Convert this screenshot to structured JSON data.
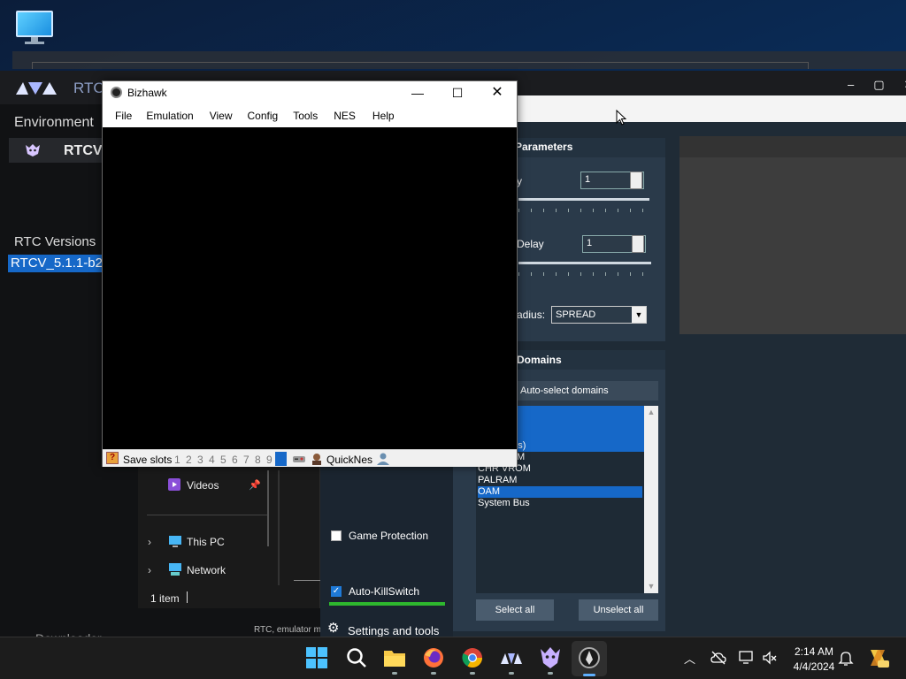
{
  "rtc_launcher": {
    "title": "RTC",
    "environment_label": "Environment",
    "environment_item": "RTCV",
    "versions_label": "RTC Versions",
    "version_selected": "RTCV_5.1.1-b2",
    "footer_text": "RTC, emulator mo",
    "downloader_label": "Downloader",
    "window_controls": [
      "–",
      "▢",
      "✕"
    ]
  },
  "rtc_client": {
    "parameters_header": "Parameters",
    "intensity_label": "y",
    "intensity_value": "1",
    "delay_label": "Delay",
    "delay_value": "1",
    "radius_label": "adius:",
    "radius_value": "SPREAD",
    "domains_header": "Domains",
    "autoselect_label": "Auto-select domains",
    "domains": [
      {
        "label": "ametables)",
        "selected": true
      },
      {
        "label": "CHR VROM",
        "selected": false
      },
      {
        "label": "PALRAM",
        "selected": false
      },
      {
        "label": "OAM",
        "selected": true
      },
      {
        "label": "System Bus",
        "selected": false
      }
    ],
    "domain_partial_m": "M",
    "select_all_label": "Select all",
    "unselect_all_label": "Unselect all",
    "game_protection_label": "Game Protection",
    "game_protection_checked": false,
    "auto_killswitch_label": "Auto-KillSwitch",
    "auto_killswitch_checked": true,
    "settings_label": "Settings and tools"
  },
  "explorer": {
    "videos_label": "Videos",
    "this_pc_label": "This PC",
    "network_label": "Network",
    "status_text": "1 item"
  },
  "bizhawk": {
    "title": "Bizhawk",
    "menu": [
      "File",
      "Emulation",
      "View",
      "Config",
      "Tools",
      "NES",
      "Help"
    ],
    "save_slots_label": "Save slots",
    "slots": [
      "1",
      "2",
      "3",
      "4",
      "5",
      "6",
      "7",
      "8",
      "9"
    ],
    "core_label": "QuickNes"
  },
  "taskbar": {
    "time": "2:14 AM",
    "date": "4/4/2024",
    "pinned": [
      "start-icon",
      "search-icon",
      "file-explorer-icon",
      "firefox-icon",
      "chrome-icon",
      "rtc-launcher-icon",
      "rtc-client-icon",
      "bizhawk-icon"
    ]
  },
  "colors": {
    "selection_blue": "#1668c8",
    "killswitch_green": "#2eb82e",
    "panel_bg": "#2a3a4a"
  }
}
